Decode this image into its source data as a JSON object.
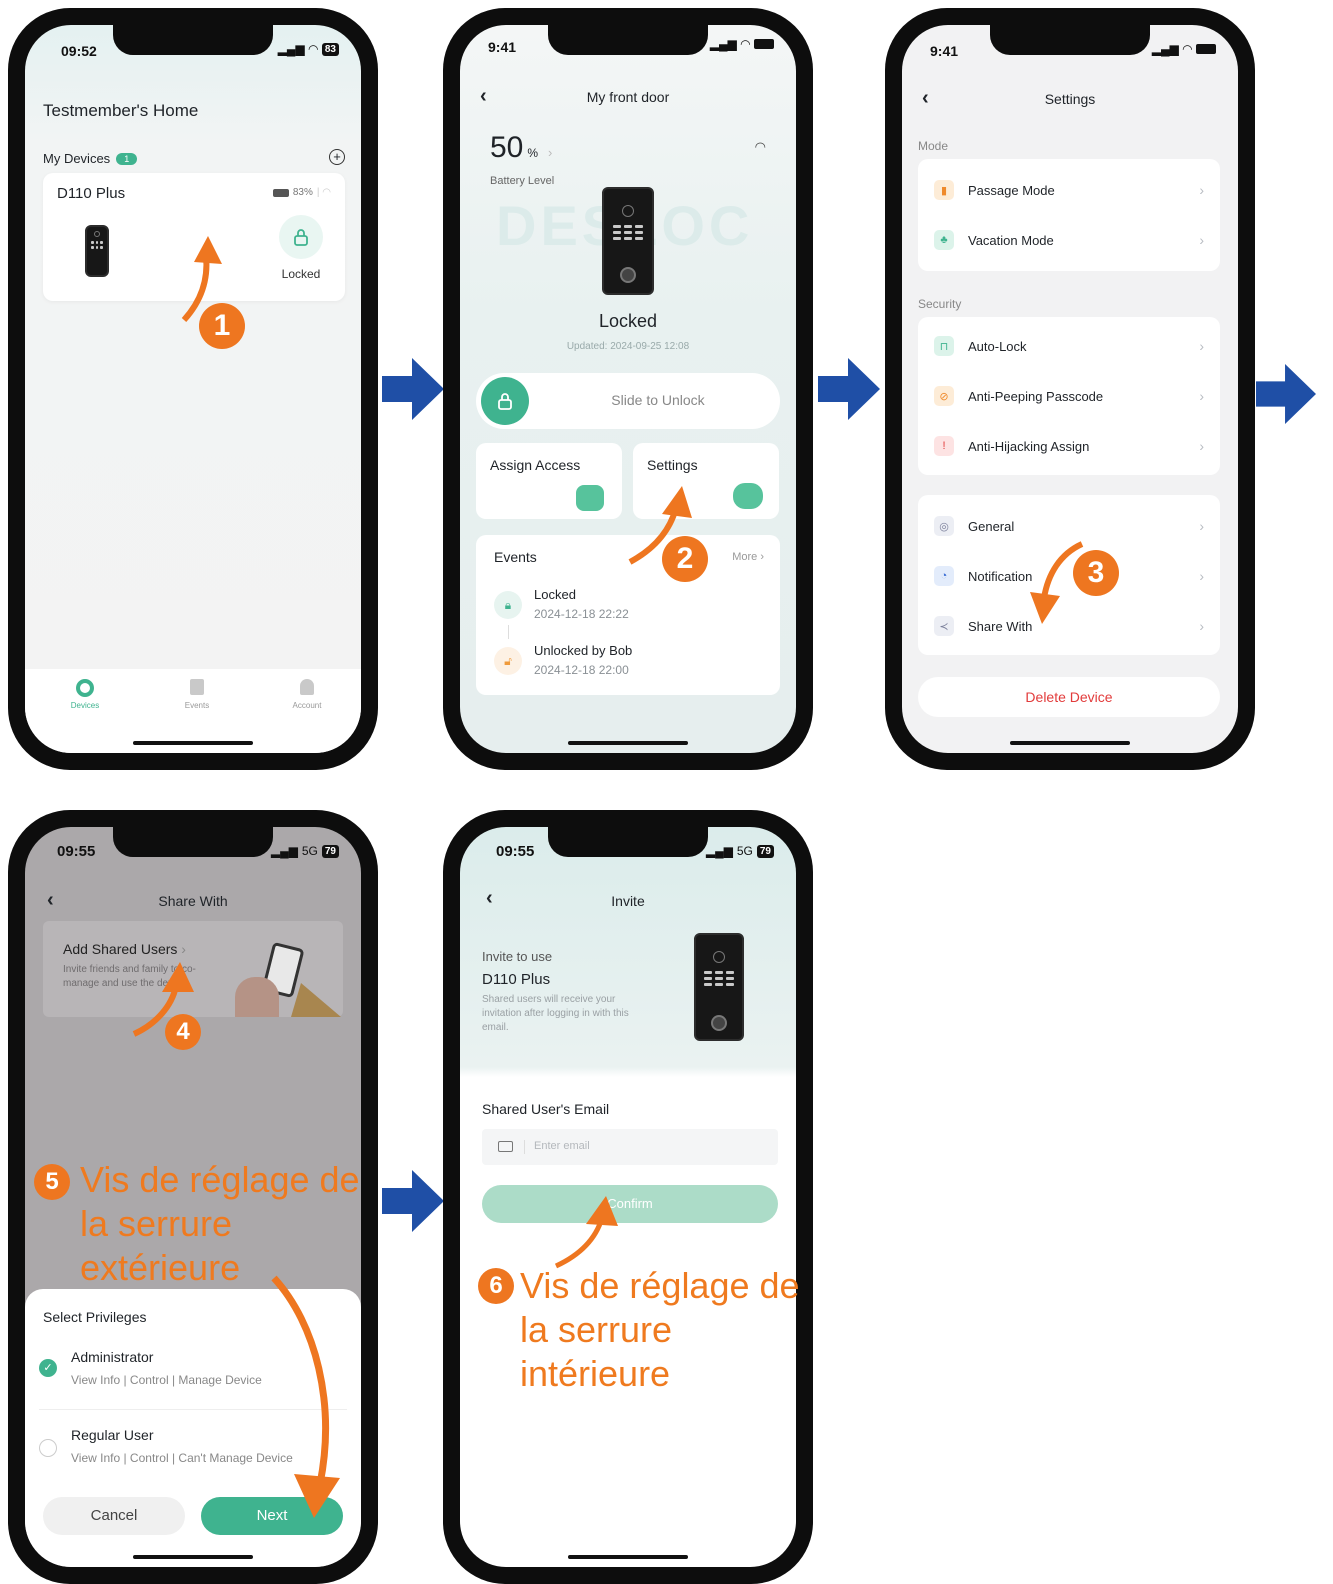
{
  "colors": {
    "accent": "#3fb38f",
    "orange": "#ee7620",
    "blue": "#1f4fa6",
    "danger": "#e23b3b"
  },
  "p1": {
    "time": "09:52",
    "battery": "83",
    "home_title": "Testmember's Home",
    "my_devices": "My Devices",
    "device_count": "1",
    "device_name": "D110 Plus",
    "device_battery": "83%",
    "status": "Locked",
    "nav": {
      "devices": "Devices",
      "events": "Events",
      "account": "Account"
    },
    "step": "1"
  },
  "p2": {
    "time": "9:41",
    "title": "My front door",
    "battery_pct": "50",
    "battery_unit": "%",
    "battery_label": "Battery Level",
    "watermark": "DESLOC",
    "status": "Locked",
    "updated": "Updated: 2024-09-25 12:08",
    "slide": "Slide to Unlock",
    "assign_access": "Assign Access",
    "settings": "Settings",
    "events_title": "Events",
    "more": "More",
    "events": [
      {
        "title": "Locked",
        "time": "2024-12-18 22:22"
      },
      {
        "title": "Unlocked by Bob",
        "time": "2024-12-18 22:00"
      }
    ],
    "step": "2"
  },
  "p3": {
    "time": "9:41",
    "title": "Settings",
    "mode_label": "Mode",
    "passage": "Passage Mode",
    "vacation": "Vacation Mode",
    "security_label": "Security",
    "autolock": "Auto-Lock",
    "antipeep": "Anti-Peeping Passcode",
    "antihijack": "Anti-Hijacking Assign",
    "general": "General",
    "notification": "Notification",
    "share": "Share With",
    "delete": "Delete Device",
    "step": "3"
  },
  "p4": {
    "time": "09:55",
    "network": "5G",
    "battery": "79",
    "title": "Share With",
    "add_title": "Add Shared Users",
    "add_desc": "Invite friends and family to co-manage and use the device.",
    "select_priv": "Select Privileges",
    "admin": "Administrator",
    "admin_desc": "View Info | Control | Manage Device",
    "regular": "Regular User",
    "regular_desc": "View Info | Control | Can't Manage Device",
    "cancel": "Cancel",
    "next": "Next",
    "step4": "4",
    "step5": "5",
    "caption": "Vis de réglage de la serrure extérieure"
  },
  "p5": {
    "time": "09:55",
    "network": "5G",
    "battery": "79",
    "title": "Invite",
    "invite_to": "Invite to use",
    "device": "D110 Plus",
    "desc": "Shared users will receive your invitation after logging in with this email.",
    "email_label": "Shared User's Email",
    "email_placeholder": "Enter email",
    "confirm": "Confirm",
    "step6": "6",
    "caption": "Vis de réglage de la serrure intérieure"
  }
}
